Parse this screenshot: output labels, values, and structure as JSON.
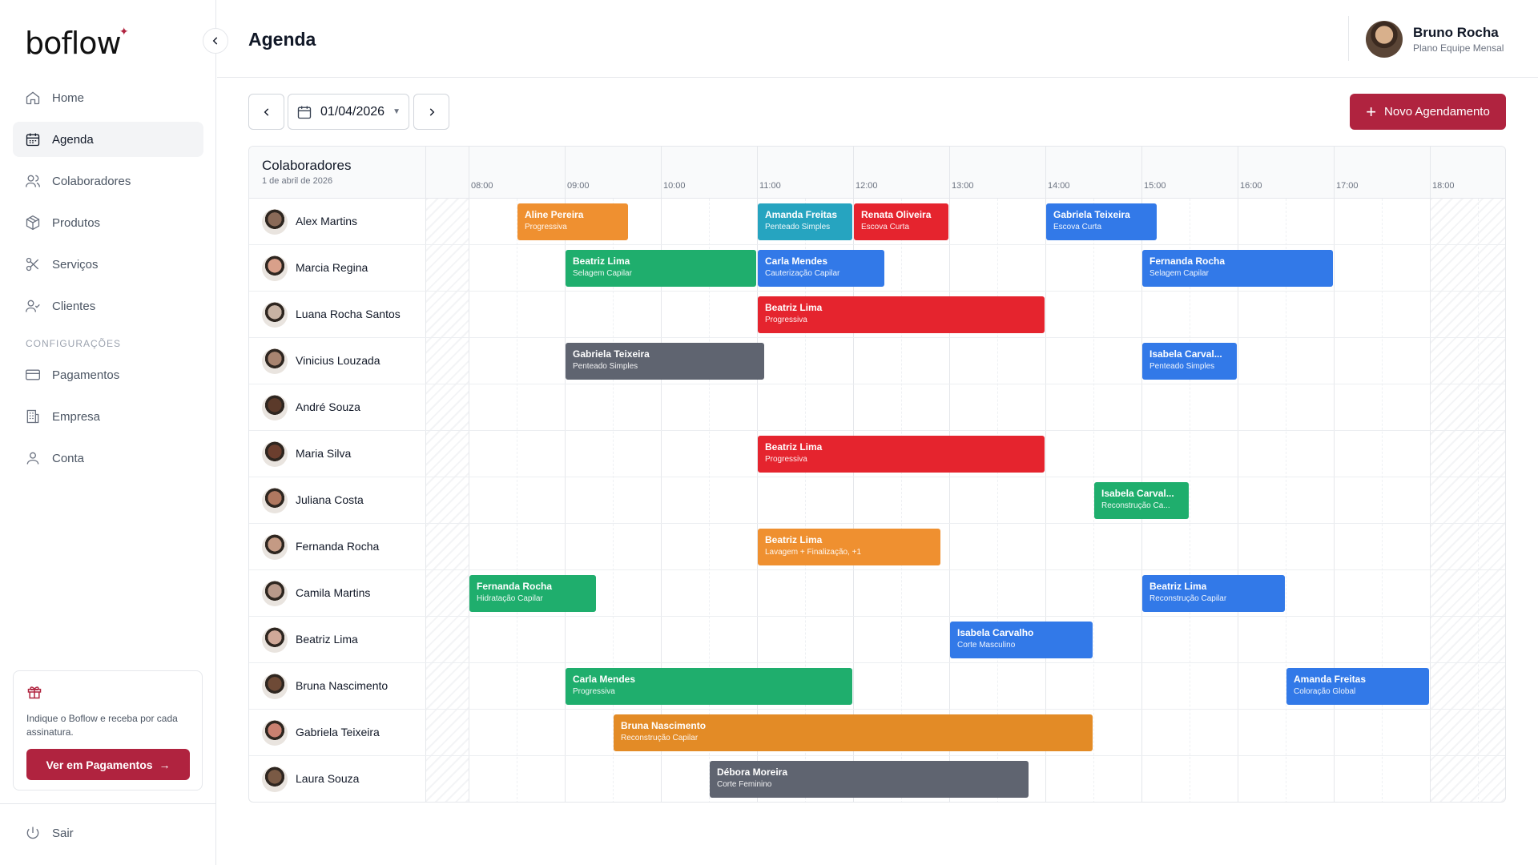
{
  "app": {
    "logo": "boflow"
  },
  "sidebar": {
    "items": [
      {
        "label": "Home",
        "icon": "home-icon"
      },
      {
        "label": "Agenda",
        "icon": "calendar-icon",
        "active": true
      },
      {
        "label": "Colaboradores",
        "icon": "users-icon"
      },
      {
        "label": "Produtos",
        "icon": "box-icon"
      },
      {
        "label": "Serviços",
        "icon": "scissors-icon"
      },
      {
        "label": "Clientes",
        "icon": "user-check-icon"
      }
    ],
    "config_label": "CONFIGURAÇÕES",
    "config_items": [
      {
        "label": "Pagamentos",
        "icon": "credit-card-icon"
      },
      {
        "label": "Empresa",
        "icon": "building-icon"
      },
      {
        "label": "Conta",
        "icon": "user-icon"
      }
    ],
    "promo": {
      "text": "Indique o Boflow e receba por cada assinatura.",
      "button": "Ver em Pagamentos"
    },
    "logout": "Sair"
  },
  "header": {
    "title": "Agenda",
    "user_name": "Bruno Rocha",
    "user_plan": "Plano Equipe Mensal"
  },
  "toolbar": {
    "date": "01/04/2026",
    "new_button": "Novo Agendamento"
  },
  "schedule": {
    "title": "Colaboradores",
    "date_label": "1 de abril de 2026",
    "hours": [
      "08:00",
      "09:00",
      "10:00",
      "11:00",
      "12:00",
      "13:00",
      "14:00",
      "15:00",
      "16:00",
      "17:00",
      "18:00"
    ],
    "colors": {
      "orange": "#ef9030",
      "teal": "#26a4c0",
      "red": "#e5242e",
      "blue": "#3279e8",
      "green": "#1fae6d",
      "gray": "#5f6470",
      "amber": "#e38b26"
    },
    "rows": [
      {
        "name": "Alex Martins",
        "avatar": "#8a6a58",
        "appointments": [
          {
            "client": "Aline Pereira",
            "service": "Progressiva",
            "start": "08:30",
            "end": "09:40",
            "color": "orange"
          },
          {
            "client": "Amanda Freitas",
            "service": "Penteado Simples",
            "start": "11:00",
            "end": "12:00",
            "color": "teal"
          },
          {
            "client": "Renata Oliveira",
            "service": "Escova Curta",
            "start": "12:00",
            "end": "13:00",
            "color": "red"
          },
          {
            "client": "Gabriela Teixeira",
            "service": "Escova Curta",
            "start": "14:00",
            "end": "15:10",
            "color": "blue"
          }
        ]
      },
      {
        "name": "Marcia Regina",
        "avatar": "#d9a08a",
        "appointments": [
          {
            "client": "Beatriz Lima",
            "service": "Selagem Capilar",
            "start": "09:00",
            "end": "11:00",
            "color": "green"
          },
          {
            "client": "Carla Mendes",
            "service": "Cauterização Capilar",
            "start": "11:00",
            "end": "12:20",
            "color": "blue"
          },
          {
            "client": "Fernanda Rocha",
            "service": "Selagem Capilar",
            "start": "15:00",
            "end": "17:00",
            "color": "blue"
          }
        ]
      },
      {
        "name": "Luana Rocha Santos",
        "avatar": "#c7b2a3",
        "appointments": [
          {
            "client": "Beatriz Lima",
            "service": "Progressiva",
            "start": "11:00",
            "end": "14:00",
            "color": "red"
          }
        ]
      },
      {
        "name": "Vinicius Louzada",
        "avatar": "#a88470",
        "appointments": [
          {
            "client": "Gabriela Teixeira",
            "service": "Penteado Simples",
            "start": "09:00",
            "end": "11:05",
            "color": "gray"
          },
          {
            "client": "Isabela Carval...",
            "service": "Penteado Simples",
            "start": "15:00",
            "end": "16:00",
            "color": "blue"
          }
        ]
      },
      {
        "name": "André Souza",
        "avatar": "#5b3a2a",
        "appointments": []
      },
      {
        "name": "Maria Silva",
        "avatar": "#6b3e2e",
        "appointments": [
          {
            "client": "Beatriz Lima",
            "service": "Progressiva",
            "start": "11:00",
            "end": "14:00",
            "color": "red"
          }
        ]
      },
      {
        "name": "Juliana Costa",
        "avatar": "#b07860",
        "appointments": [
          {
            "client": "Isabela Carval...",
            "service": "Reconstrução Ca...",
            "start": "14:30",
            "end": "15:30",
            "color": "green"
          }
        ]
      },
      {
        "name": "Fernanda Rocha",
        "avatar": "#c49a84",
        "appointments": [
          {
            "client": "Beatriz Lima",
            "service": "Lavagem + Finalização, +1",
            "start": "11:00",
            "end": "12:55",
            "color": "orange"
          }
        ]
      },
      {
        "name": "Camila Martins",
        "avatar": "#b8998a",
        "appointments": [
          {
            "client": "Fernanda Rocha",
            "service": "Hidratação Capilar",
            "start": "08:00",
            "end": "09:20",
            "color": "green"
          },
          {
            "client": "Beatriz Lima",
            "service": "Reconstrução Capilar",
            "start": "15:00",
            "end": "16:30",
            "color": "blue"
          }
        ]
      },
      {
        "name": "Beatriz Lima",
        "avatar": "#cfa898",
        "appointments": [
          {
            "client": "Isabela Carvalho",
            "service": "Corte Masculino",
            "start": "13:00",
            "end": "14:30",
            "color": "blue"
          }
        ]
      },
      {
        "name": "Bruna Nascimento",
        "avatar": "#6e4a36",
        "appointments": [
          {
            "client": "Carla Mendes",
            "service": "Progressiva",
            "start": "09:00",
            "end": "12:00",
            "color": "green"
          },
          {
            "client": "Amanda Freitas",
            "service": "Coloração Global",
            "start": "16:30",
            "end": "18:00",
            "color": "blue"
          }
        ]
      },
      {
        "name": "Gabriela Teixeira",
        "avatar": "#c98070",
        "appointments": [
          {
            "client": "Bruna Nascimento",
            "service": "Reconstrução Capilar",
            "start": "09:30",
            "end": "14:30",
            "color": "amber"
          }
        ]
      },
      {
        "name": "Laura Souza",
        "avatar": "#7a5a45",
        "appointments": [
          {
            "client": "Débora Moreira",
            "service": "Corte Feminino",
            "start": "10:30",
            "end": "13:50",
            "color": "gray"
          }
        ]
      }
    ]
  }
}
